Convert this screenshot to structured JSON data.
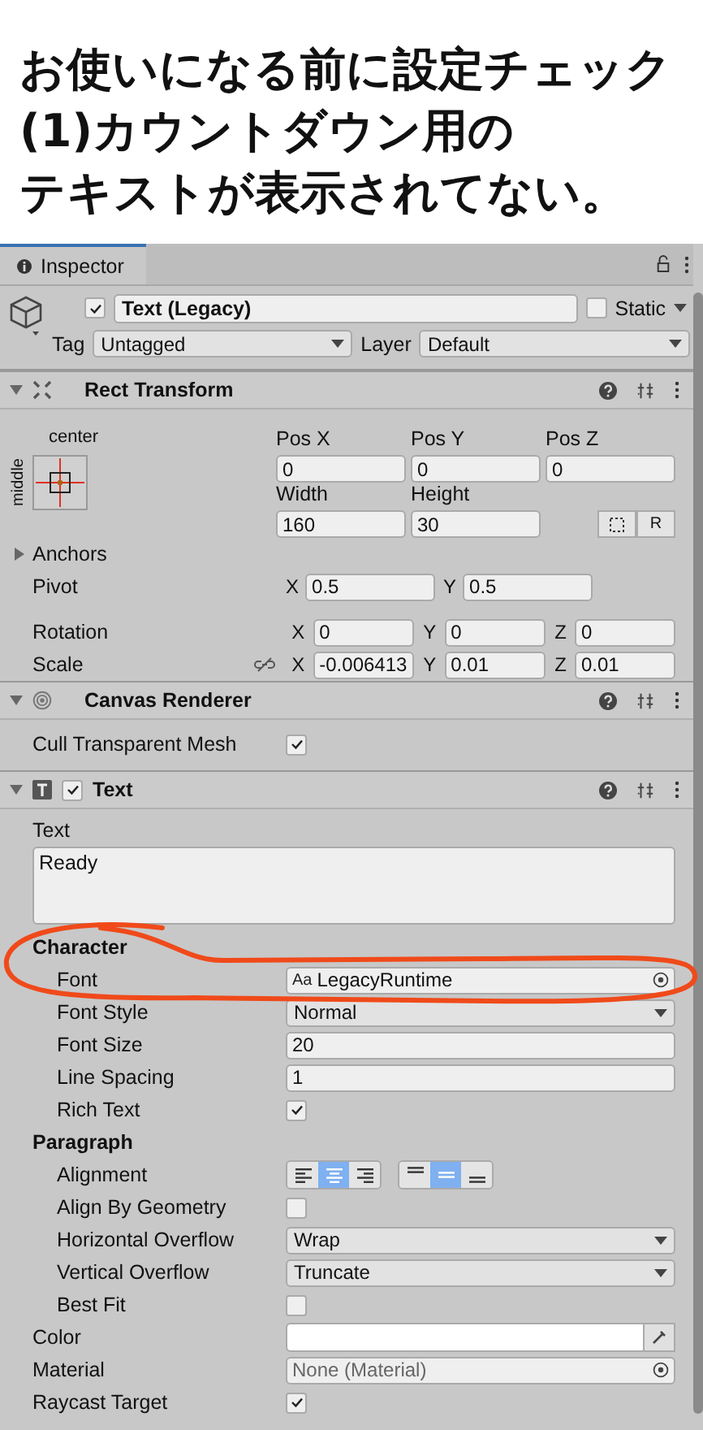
{
  "caption": {
    "lines": [
      "お使いになる前に設定チェック",
      "(1)カウントダウン用の",
      "テキストが表示されてない。"
    ]
  },
  "inspector": {
    "tab": {
      "label": "Inspector",
      "selected": true
    },
    "locked": false
  },
  "object": {
    "active": true,
    "name": "Text (Legacy)",
    "static": false,
    "static_label": "Static",
    "tag_label": "Tag",
    "tag": "Untagged",
    "layer_label": "Layer",
    "layer": "Default"
  },
  "rect_transform": {
    "title": "Rect Transform",
    "expanded": true,
    "anchor": {
      "horizontal": "center",
      "vertical": "middle"
    },
    "position": [
      {
        "label": "Pos X",
        "value": "0"
      },
      {
        "label": "Pos Y",
        "value": "0"
      },
      {
        "label": "Pos Z",
        "value": "0"
      }
    ],
    "size": [
      {
        "label": "Width",
        "value": "160"
      },
      {
        "label": "Height",
        "value": "30"
      }
    ],
    "raw_button": "R",
    "anchors": {
      "label": "Anchors",
      "expanded": false
    },
    "pivot": {
      "label": "Pivot",
      "axes": [
        {
          "axis": "X",
          "value": "0.5"
        },
        {
          "axis": "Y",
          "value": "0.5"
        }
      ]
    },
    "rotation": {
      "label": "Rotation",
      "axes": [
        {
          "axis": "X",
          "value": "0"
        },
        {
          "axis": "Y",
          "value": "0"
        },
        {
          "axis": "Z",
          "value": "0"
        }
      ]
    },
    "scale": {
      "label": "Scale",
      "linked": false,
      "axes": [
        {
          "axis": "X",
          "value": "-0.006413"
        },
        {
          "axis": "Y",
          "value": "0.01"
        },
        {
          "axis": "Z",
          "value": "0.01"
        }
      ]
    }
  },
  "canvas_renderer": {
    "title": "Canvas Renderer",
    "expanded": true,
    "rows": [
      {
        "label": "Cull Transparent Mesh",
        "checked": true
      }
    ]
  },
  "text_component": {
    "title": "Text",
    "expanded": true,
    "enabled": true,
    "text_label": "Text",
    "text": "Ready",
    "rows": [
      {
        "kind": "heading",
        "label": "Character"
      },
      {
        "kind": "object",
        "label": "Font",
        "prefix": "Aa",
        "value": "LegacyRuntime",
        "none": false,
        "indent": true
      },
      {
        "kind": "dropdown",
        "label": "Font Style",
        "value": "Normal",
        "indent": true
      },
      {
        "kind": "field",
        "label": "Font Size",
        "value": "20",
        "indent": true
      },
      {
        "kind": "field",
        "label": "Line Spacing",
        "value": "1",
        "indent": true
      },
      {
        "kind": "checkbox",
        "label": "Rich Text",
        "checked": true,
        "indent": true
      },
      {
        "kind": "heading",
        "label": "Paragraph"
      },
      {
        "kind": "alignment",
        "label": "Alignment",
        "indent": true,
        "groups": [
          {
            "options": [
              {
                "selected": false
              },
              {
                "selected": true
              },
              {
                "selected": false
              }
            ]
          },
          {
            "options": [
              {
                "selected": false
              },
              {
                "selected": true
              },
              {
                "selected": false
              }
            ]
          }
        ]
      },
      {
        "kind": "checkbox",
        "label": "Align By Geometry",
        "checked": false,
        "indent": true
      },
      {
        "kind": "dropdown",
        "label": "Horizontal Overflow",
        "value": "Wrap",
        "indent": true
      },
      {
        "kind": "dropdown",
        "label": "Vertical Overflow",
        "value": "Truncate",
        "indent": true
      },
      {
        "kind": "checkbox",
        "label": "Best Fit",
        "checked": false,
        "indent": true
      },
      {
        "kind": "color",
        "label": "Color",
        "color": "#ffffff",
        "indent": false
      },
      {
        "kind": "object",
        "label": "Material",
        "value": "None (Material)",
        "none": true,
        "indent": false
      },
      {
        "kind": "checkbox",
        "label": "Raycast Target",
        "checked": true,
        "indent": false
      }
    ]
  }
}
